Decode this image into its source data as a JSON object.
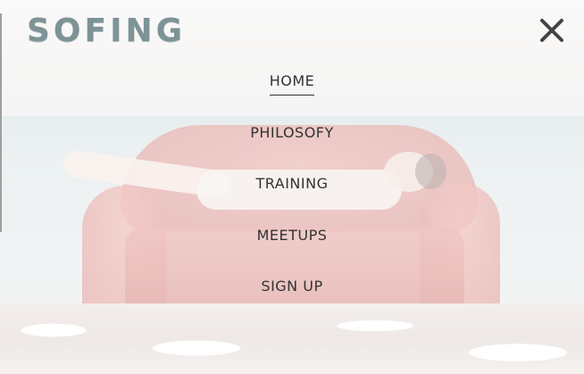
{
  "brand": {
    "logo_text": "SOFING"
  },
  "header": {
    "close_icon": "close-icon"
  },
  "nav": {
    "items": [
      {
        "label": "HOME",
        "active": true
      },
      {
        "label": "PHILOSOFY",
        "active": false
      },
      {
        "label": "TRAINING",
        "active": false
      },
      {
        "label": "MEETUPS",
        "active": false
      },
      {
        "label": "SIGN UP",
        "active": false
      }
    ]
  },
  "colors": {
    "logo": "#7d9396",
    "menu_text": "#333333",
    "close_icon": "#444444",
    "sofa": "#c8352b"
  },
  "background": {
    "icon": "sofa-beach-image"
  }
}
